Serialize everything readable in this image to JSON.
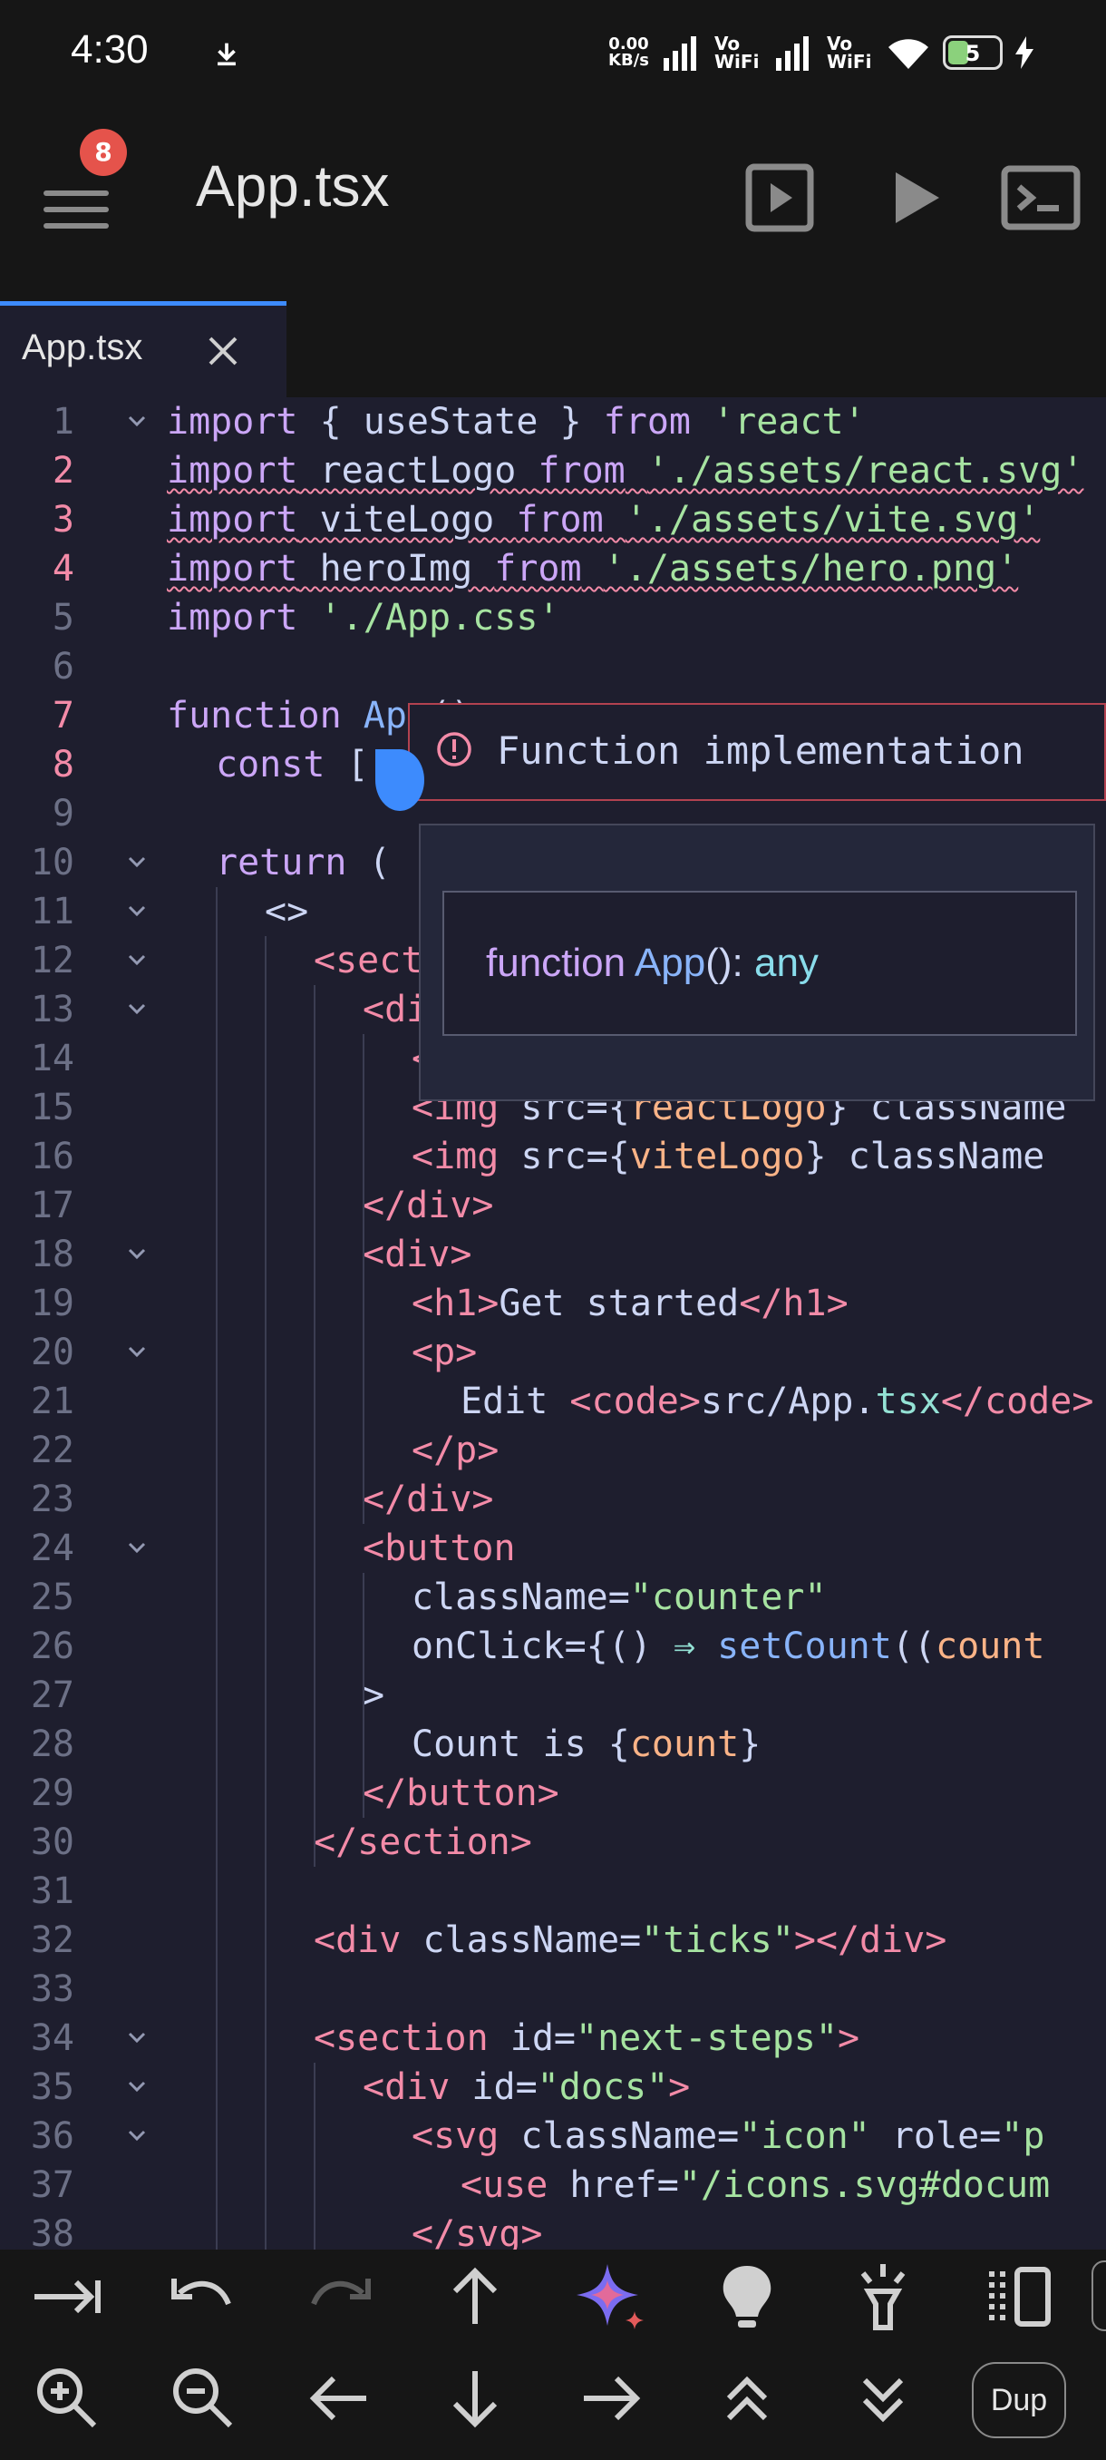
{
  "status": {
    "time": "4:30",
    "net_speed_value": "0.00",
    "net_speed_unit": "KB/s",
    "vowifi_1": "Vo WiFi",
    "vowifi_2": "Vo WiFi",
    "battery": "5"
  },
  "appbar": {
    "menu_badge": "8",
    "title": "App.tsx"
  },
  "tab": {
    "label": "App.tsx"
  },
  "editor": {
    "error_lines": [
      2,
      3,
      4,
      7,
      8
    ],
    "lines": [
      {
        "n": "1",
        "fold": true,
        "indent": 0,
        "parts": [
          [
            "kw",
            "import"
          ],
          [
            "txt",
            " { useState } "
          ],
          [
            "kw",
            "from"
          ],
          [
            "txt",
            " "
          ],
          [
            "str",
            "'react'"
          ]
        ]
      },
      {
        "n": "2",
        "fold": false,
        "indent": 0,
        "squiggle": true,
        "parts": [
          [
            "kw",
            "import"
          ],
          [
            "txt",
            " reactLogo "
          ],
          [
            "kw",
            "from"
          ],
          [
            "txt",
            " "
          ],
          [
            "str",
            "'./assets/react.svg'"
          ]
        ]
      },
      {
        "n": "3",
        "fold": false,
        "indent": 0,
        "squiggle": true,
        "parts": [
          [
            "kw",
            "import"
          ],
          [
            "txt",
            " viteLogo "
          ],
          [
            "kw",
            "from"
          ],
          [
            "txt",
            " "
          ],
          [
            "str",
            "'./assets/vite.svg'"
          ]
        ]
      },
      {
        "n": "4",
        "fold": false,
        "indent": 0,
        "squiggle": true,
        "parts": [
          [
            "kw",
            "import"
          ],
          [
            "txt",
            " heroImg "
          ],
          [
            "kw",
            "from"
          ],
          [
            "txt",
            " "
          ],
          [
            "str",
            "'./assets/hero.png'"
          ]
        ]
      },
      {
        "n": "5",
        "fold": false,
        "indent": 0,
        "parts": [
          [
            "kw",
            "import"
          ],
          [
            "txt",
            " "
          ],
          [
            "str",
            "'./App.css'"
          ]
        ]
      },
      {
        "n": "6",
        "fold": false,
        "indent": 0,
        "parts": []
      },
      {
        "n": "7",
        "fold": false,
        "indent": 0,
        "parts": [
          [
            "kw",
            "function"
          ],
          [
            "txt",
            " "
          ],
          [
            "fn",
            "App"
          ],
          [
            "txt",
            "()"
          ]
        ]
      },
      {
        "n": "8",
        "fold": false,
        "indent": 1,
        "parts": [
          [
            "kw",
            "const"
          ],
          [
            "txt",
            " ["
          ]
        ]
      },
      {
        "n": "9",
        "fold": false,
        "indent": 0,
        "parts": []
      },
      {
        "n": "10",
        "fold": true,
        "indent": 1,
        "parts": [
          [
            "kw",
            "return"
          ],
          [
            "txt",
            " ("
          ]
        ]
      },
      {
        "n": "11",
        "fold": true,
        "indent": 2,
        "parts": [
          [
            "txt",
            "<>"
          ]
        ]
      },
      {
        "n": "12",
        "fold": true,
        "indent": 3,
        "parts": [
          [
            "tag",
            "<section"
          ]
        ]
      },
      {
        "n": "13",
        "fold": true,
        "indent": 4,
        "parts": [
          [
            "tag",
            "<div"
          ]
        ]
      },
      {
        "n": "14",
        "fold": false,
        "indent": 5,
        "parts": [
          [
            "tag",
            "<img"
          ]
        ]
      },
      {
        "n": "15",
        "fold": false,
        "indent": 5,
        "parts": [
          [
            "tag",
            "<img"
          ],
          [
            "txt",
            " src={"
          ],
          [
            "num",
            "reactLogo"
          ],
          [
            "txt",
            "} className"
          ]
        ]
      },
      {
        "n": "16",
        "fold": false,
        "indent": 5,
        "parts": [
          [
            "tag",
            "<img"
          ],
          [
            "txt",
            " src={"
          ],
          [
            "num",
            "viteLogo"
          ],
          [
            "txt",
            "} className"
          ]
        ]
      },
      {
        "n": "17",
        "fold": false,
        "indent": 4,
        "parts": [
          [
            "tag",
            "</div>"
          ]
        ]
      },
      {
        "n": "18",
        "fold": true,
        "indent": 4,
        "parts": [
          [
            "tag",
            "<div>"
          ]
        ]
      },
      {
        "n": "19",
        "fold": false,
        "indent": 5,
        "parts": [
          [
            "tag",
            "<h1>"
          ],
          [
            "txt",
            "Get started"
          ],
          [
            "tag",
            "</h1>"
          ]
        ]
      },
      {
        "n": "20",
        "fold": true,
        "indent": 5,
        "parts": [
          [
            "tag",
            "<p>"
          ]
        ]
      },
      {
        "n": "21",
        "fold": false,
        "indent": 6,
        "parts": [
          [
            "txt",
            "Edit "
          ],
          [
            "tag",
            "<code>"
          ],
          [
            "txt",
            "src/App."
          ],
          [
            "op",
            "tsx"
          ],
          [
            "tag",
            "</code>"
          ]
        ]
      },
      {
        "n": "22",
        "fold": false,
        "indent": 5,
        "parts": [
          [
            "tag",
            "</p>"
          ]
        ]
      },
      {
        "n": "23",
        "fold": false,
        "indent": 4,
        "parts": [
          [
            "tag",
            "</div>"
          ]
        ]
      },
      {
        "n": "24",
        "fold": true,
        "indent": 4,
        "parts": [
          [
            "tag",
            "<button"
          ]
        ]
      },
      {
        "n": "25",
        "fold": false,
        "indent": 5,
        "parts": [
          [
            "txt",
            "className="
          ],
          [
            "str",
            "\"counter\""
          ]
        ]
      },
      {
        "n": "26",
        "fold": false,
        "indent": 5,
        "parts": [
          [
            "txt",
            "onClick={() "
          ],
          [
            "op",
            "⇒"
          ],
          [
            "txt",
            " "
          ],
          [
            "fn",
            "setCount"
          ],
          [
            "txt",
            "(("
          ],
          [
            "num",
            "count"
          ]
        ]
      },
      {
        "n": "27",
        "fold": false,
        "indent": 4,
        "parts": [
          [
            "txt",
            ">"
          ]
        ]
      },
      {
        "n": "28",
        "fold": false,
        "indent": 5,
        "parts": [
          [
            "txt",
            "Count is {"
          ],
          [
            "num",
            "count"
          ],
          [
            "txt",
            "}"
          ]
        ]
      },
      {
        "n": "29",
        "fold": false,
        "indent": 4,
        "parts": [
          [
            "tag",
            "</button>"
          ]
        ]
      },
      {
        "n": "30",
        "fold": false,
        "indent": 3,
        "parts": [
          [
            "tag",
            "</section>"
          ]
        ]
      },
      {
        "n": "31",
        "fold": false,
        "indent": 0,
        "parts": []
      },
      {
        "n": "32",
        "fold": false,
        "indent": 3,
        "parts": [
          [
            "tag",
            "<div"
          ],
          [
            "txt",
            " className="
          ],
          [
            "str",
            "\"ticks\""
          ],
          [
            "tag",
            "></div>"
          ]
        ]
      },
      {
        "n": "33",
        "fold": false,
        "indent": 0,
        "parts": []
      },
      {
        "n": "34",
        "fold": true,
        "indent": 3,
        "parts": [
          [
            "tag",
            "<section"
          ],
          [
            "txt",
            " id="
          ],
          [
            "str",
            "\"next-steps\""
          ],
          [
            "tag",
            ">"
          ]
        ]
      },
      {
        "n": "35",
        "fold": true,
        "indent": 4,
        "parts": [
          [
            "tag",
            "<div"
          ],
          [
            "txt",
            " id="
          ],
          [
            "str",
            "\"docs\""
          ],
          [
            "tag",
            ">"
          ]
        ]
      },
      {
        "n": "36",
        "fold": true,
        "indent": 5,
        "parts": [
          [
            "tag",
            "<svg"
          ],
          [
            "txt",
            " className="
          ],
          [
            "str",
            "\"icon\""
          ],
          [
            "txt",
            " role="
          ],
          [
            "str",
            "\"p"
          ]
        ]
      },
      {
        "n": "37",
        "fold": false,
        "indent": 6,
        "parts": [
          [
            "tag",
            "<use"
          ],
          [
            "txt",
            " href="
          ],
          [
            "str",
            "\"/icons.svg#docum"
          ]
        ]
      },
      {
        "n": "38",
        "fold": false,
        "indent": 5,
        "parts": [
          [
            "tag",
            "</svg>"
          ]
        ]
      }
    ]
  },
  "error_popup": {
    "message": "Function implementation"
  },
  "hover": {
    "keyword": "function",
    "name": "App",
    "signature_rest": "():",
    "type": "any"
  },
  "toolbar": {
    "dup_label": "Dup"
  }
}
